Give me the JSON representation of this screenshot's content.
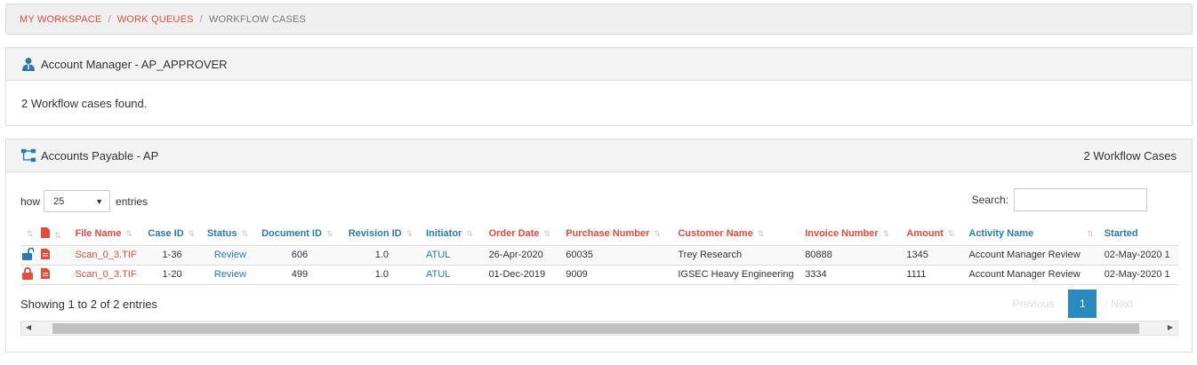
{
  "breadcrumb": {
    "items": [
      "MY WORKSPACE",
      "WORK QUEUES"
    ],
    "current": "WORKFLOW CASES",
    "separator": "/"
  },
  "role_panel": {
    "title": "Account Manager - AP_APPROVER",
    "message": "2 Workflow cases found."
  },
  "process_panel": {
    "title": "Accounts Payable - AP",
    "count_label": "2 Workflow Cases",
    "show_label": "how",
    "page_length": "25",
    "entries_label": "entries",
    "search_label": "Search:",
    "search_value": "",
    "columns": [
      "File Name",
      "Case ID",
      "Status",
      "Document ID",
      "Revision ID",
      "Initiator",
      "Order Date",
      "Purchase Number",
      "Customer Name",
      "Invoice Number",
      "Amount",
      "Activity Name",
      "Started"
    ],
    "rows": [
      {
        "lock": "unlocked",
        "file_name": "Scan_0_3.TIF",
        "case_id": "1-36",
        "status": "Review",
        "document_id": "606",
        "revision_id": "1.0",
        "initiator": "ATUL",
        "order_date": "26-Apr-2020",
        "purchase_number": "60035",
        "customer_name": "Trey Research",
        "invoice_number": "80888",
        "amount": "1345",
        "activity_name": "Account Manager Review",
        "started": "02-May-2020 1"
      },
      {
        "lock": "locked",
        "file_name": "Scan_0_3.TIF",
        "case_id": "1-20",
        "status": "Review",
        "document_id": "499",
        "revision_id": "1.0",
        "initiator": "ATUL",
        "order_date": "01-Dec-2019",
        "purchase_number": "9009",
        "customer_name": "IGSEC Heavy Engineering",
        "invoice_number": "3334",
        "amount": "1111",
        "activity_name": "Account Manager Review",
        "started": "02-May-2020 1"
      }
    ],
    "info_text": "Showing 1 to 2 of 2 entries",
    "pagination": {
      "previous": "Previous",
      "current": "1",
      "next": "Next"
    }
  },
  "colors": {
    "accent_red": "#e44b3f",
    "accent_blue": "#2a7ab0",
    "page_button": "#2a8ac0"
  },
  "icons": [
    "user-icon",
    "workflow-icon",
    "lock-open-icon",
    "lock-closed-icon",
    "pdf-file-icon"
  ]
}
